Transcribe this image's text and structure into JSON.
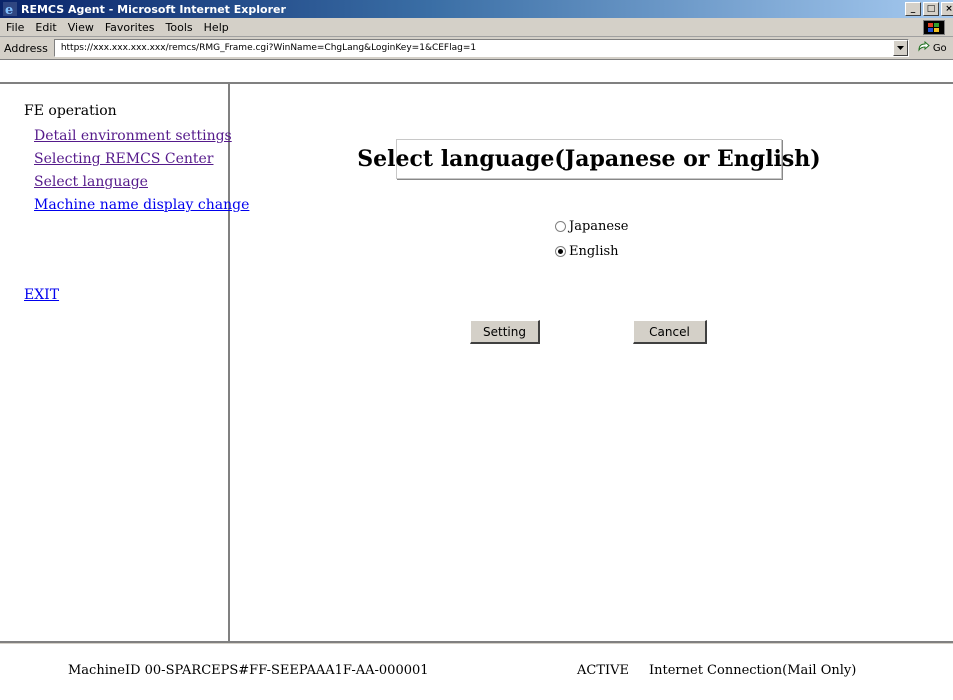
{
  "window": {
    "title": "REMCS Agent - Microsoft Internet Explorer",
    "controls": {
      "minimize": "_",
      "maximize": "□",
      "close": "×"
    }
  },
  "menu": {
    "items": [
      {
        "label": "File"
      },
      {
        "label": "Edit"
      },
      {
        "label": "View"
      },
      {
        "label": "Favorites"
      },
      {
        "label": "Tools"
      },
      {
        "label": "Help"
      }
    ]
  },
  "address": {
    "label": "Address",
    "url": "https://xxx.xxx.xxx.xxx/remcs/RMG_Frame.cgi?WinName=ChgLang&LoginKey=1&CEFlag=1",
    "go_label": "Go"
  },
  "sidebar": {
    "section_title": "FE operation",
    "links": [
      {
        "label": "Detail environment settings",
        "visited": true
      },
      {
        "label": "Selecting REMCS Center",
        "visited": true
      },
      {
        "label": "Select language",
        "visited": true
      },
      {
        "label": "Machine name display change",
        "visited": false
      }
    ],
    "exit_label": "EXIT"
  },
  "main": {
    "heading": "Select language(Japanese or English)",
    "options": [
      {
        "label": "Japanese",
        "selected": false
      },
      {
        "label": "English",
        "selected": true
      }
    ],
    "setting_button": "Setting",
    "cancel_button": "Cancel"
  },
  "status": {
    "machine_id": "MachineID  00-SPARCEPS#FF-SEEPAAA1F-AA-000001",
    "state": "ACTIVE",
    "connection": "Internet Connection(Mail Only)"
  },
  "icons": {
    "browser": "ie-icon",
    "windows_logo": "windows-logo-icon",
    "go": "go-arrow-icon",
    "dropdown": "chevron-down-icon"
  },
  "colors": {
    "titlebar": "#0a246a",
    "visited_link": "#551a8b",
    "link": "#0000ee",
    "chrome": "#d4d0c8"
  }
}
